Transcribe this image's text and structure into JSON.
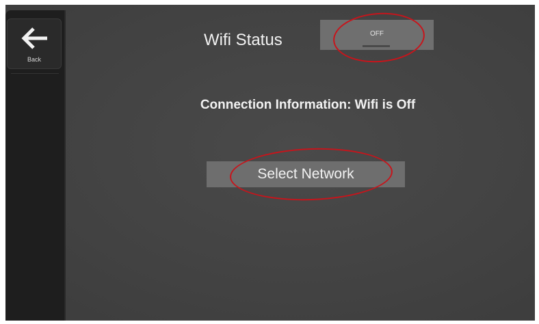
{
  "sidebar": {
    "back_label": "Back"
  },
  "wifi": {
    "status_label": "Wifi Status",
    "toggle_value": "OFF"
  },
  "connection": {
    "info_text": "Connection Information: Wifi is Off"
  },
  "network": {
    "select_label": "Select Network"
  },
  "colors": {
    "background": "#444444",
    "button": "#6e6e6e",
    "annotation": "#c8141b"
  }
}
